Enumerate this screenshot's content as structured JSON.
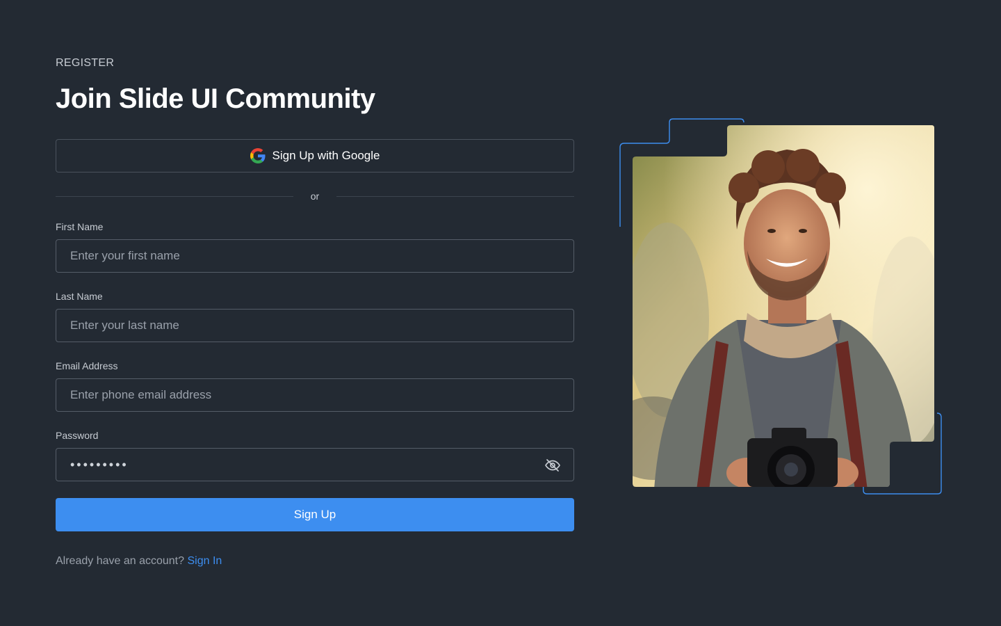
{
  "header": {
    "eyebrow": "REGISTER",
    "title": "Join Slide UI Community"
  },
  "google": {
    "label": "Sign Up with Google",
    "icon": "google-icon"
  },
  "divider": {
    "text": "or"
  },
  "fields": {
    "first_name": {
      "label": "First Name",
      "placeholder": "Enter your first name"
    },
    "last_name": {
      "label": "Last Name",
      "placeholder": "Enter your last name"
    },
    "email": {
      "label": "Email Address",
      "placeholder": "Enter phone email address"
    },
    "password": {
      "label": "Password",
      "value": "•••••••••",
      "toggle_icon": "eye-off-icon"
    }
  },
  "submit": {
    "label": "Sign Up"
  },
  "footer": {
    "prompt": "Already have an account?",
    "link": "Sign In"
  },
  "colors": {
    "background": "#232a33",
    "accent": "#3d8ef0",
    "input_border": "#555d68",
    "frame_outline": "#3d8ef0"
  }
}
